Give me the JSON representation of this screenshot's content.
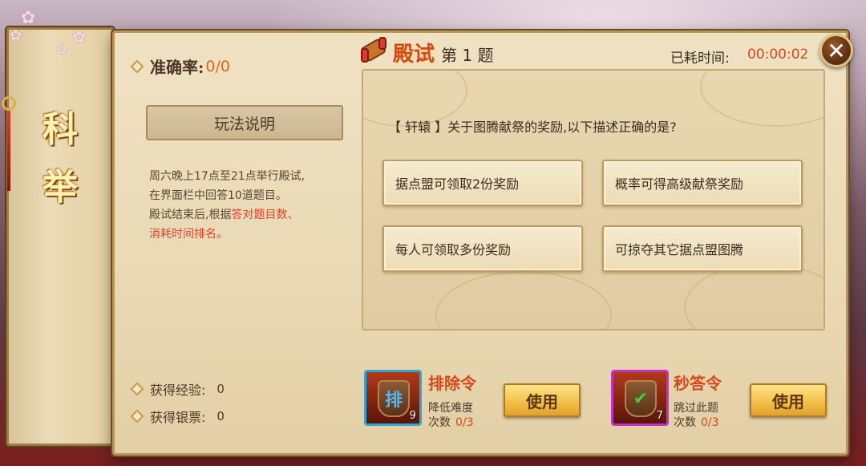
{
  "side": {
    "title_1": "科",
    "title_2": "举"
  },
  "accuracy": {
    "label": "准确率:",
    "value": "0/0"
  },
  "rules": {
    "button_label": "玩法说明",
    "line1": "周六晚上17点至21点举行殿试,",
    "line2": "在界面栏中回答10道题目。",
    "line3_a": "殿试结束后,根据",
    "line3_b": "答对题目数、",
    "line4": "消耗时间排名。"
  },
  "rewards": [
    {
      "label": "获得经验:",
      "value": "0"
    },
    {
      "label": "获得银票:",
      "value": "0"
    }
  ],
  "header": {
    "title": "殿试",
    "question_number": "第 1 题",
    "timer_label": "已耗时间:",
    "timer_value": "00:00:02"
  },
  "question": {
    "text": "【 轩辕 】关于图腾献祭的奖励,以下描述正确的是?",
    "options": [
      "据点盟可领取2份奖励",
      "概率可得高级献祭奖励",
      "每人可领取多份奖励",
      "可掠夺其它据点盟图腾"
    ]
  },
  "items": [
    {
      "name": "排除令",
      "desc": "降低难度",
      "count_label": "次数",
      "count_value": "0/3",
      "badge": "9",
      "glyph": "排",
      "use_label": "使用",
      "frame_color": "#2fa6d8"
    },
    {
      "name": "秒答令",
      "desc": "跳过此题",
      "count_label": "次数",
      "count_value": "0/3",
      "badge": "7",
      "glyph": "✔",
      "use_label": "使用",
      "frame_color": "#c232c8"
    }
  ],
  "colors": {
    "accent": "#d24a1a",
    "parchment": "#efe2c3"
  }
}
